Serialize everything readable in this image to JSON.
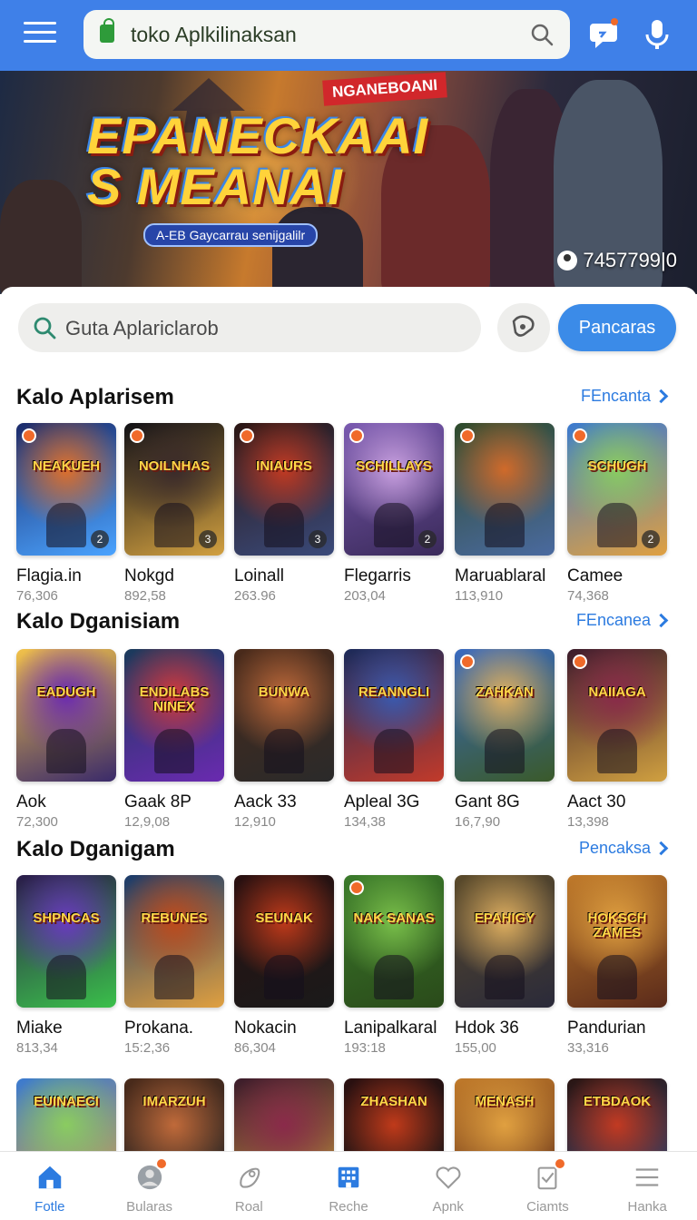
{
  "topbar": {
    "url": "toko Aplkilinaksan"
  },
  "hero": {
    "badge": "NGANEBOANI",
    "title": "EPANECKAAI\nS MEANAI",
    "subtitle": "A-EB Gaycarrau senijgalilr",
    "count": "7457799|0"
  },
  "search": {
    "placeholder": "Guta Aplaricl​arob",
    "primary_label": "Pancaras"
  },
  "sections": [
    {
      "title": "Kalo Aplarisem",
      "see_all": "FEncanta",
      "cards": [
        {
          "name": "Flagia.in",
          "meta": "76,306",
          "tile": "NEAKUEH",
          "num": "2"
        },
        {
          "name": "Nokgd",
          "meta": "892,58",
          "tile": "NOILNHAS",
          "num": "3"
        },
        {
          "name": "Loinall",
          "meta": "263.96",
          "tile": "INIAURS",
          "num": "3"
        },
        {
          "name": "Flegarris",
          "meta": "203,04",
          "tile": "SCHILLAYS",
          "num": "2"
        },
        {
          "name": "Maruablaral",
          "meta": "113,910",
          "tile": "",
          "num": ""
        },
        {
          "name": "Camee",
          "meta": "74,368",
          "tile": "SCHUGH",
          "num": "2"
        }
      ]
    },
    {
      "title": "Kalo Dganisiam",
      "see_all": "FEncanea",
      "cards": [
        {
          "name": "Aok",
          "meta": "72,300",
          "tile": "EADUGH",
          "num": ""
        },
        {
          "name": "Gaak 8P",
          "meta": "12,9,08",
          "tile": "ENDILABS NINEX",
          "num": ""
        },
        {
          "name": "Aack 33",
          "meta": "12,910",
          "tile": "BUNWA",
          "num": ""
        },
        {
          "name": "Apleal 3G",
          "meta": "134,38",
          "tile": "REANNGLI",
          "num": ""
        },
        {
          "name": "Gant 8G",
          "meta": "16,7,90",
          "tile": "ZAHKAN",
          "num": ""
        },
        {
          "name": "Aact 30",
          "meta": "13,398",
          "tile": "NAIIAGA",
          "num": ""
        }
      ]
    },
    {
      "title": "Kalo Dganigam",
      "see_all": "Pencaksa",
      "cards": [
        {
          "name": "Miake",
          "meta": "813,34",
          "tile": "SHPNCAS",
          "num": ""
        },
        {
          "name": "Prokana.",
          "meta": "15:2,36",
          "tile": "REBUNES",
          "num": ""
        },
        {
          "name": "Nokacin",
          "meta": "86,304",
          "tile": "SEUNAK",
          "num": ""
        },
        {
          "name": "Lanipalkaral",
          "meta": "193:18",
          "tile": "NAK SANAS",
          "num": ""
        },
        {
          "name": "Hdok 36",
          "meta": "155,00",
          "tile": "EPAHIGY",
          "num": ""
        },
        {
          "name": "Pandurian",
          "meta": "33,316",
          "tile": "HOKSCH ZAMES",
          "num": ""
        }
      ]
    }
  ],
  "partial_row": [
    "EUINAECI",
    "IMARZUH",
    "",
    "ZHASHAN",
    "MENASH",
    "ETBDAOK"
  ],
  "bottom_nav": [
    {
      "label": "Fotle",
      "icon": "home-icon"
    },
    {
      "label": "Bularas",
      "icon": "avatar-icon"
    },
    {
      "label": "Roal",
      "icon": "rocket-icon"
    },
    {
      "label": "Reche",
      "icon": "building-icon"
    },
    {
      "label": "Apnk",
      "icon": "heart-icon"
    },
    {
      "label": "Ciamts",
      "icon": "clipboard-icon"
    },
    {
      "label": "Hanka",
      "icon": "menu-icon"
    }
  ]
}
